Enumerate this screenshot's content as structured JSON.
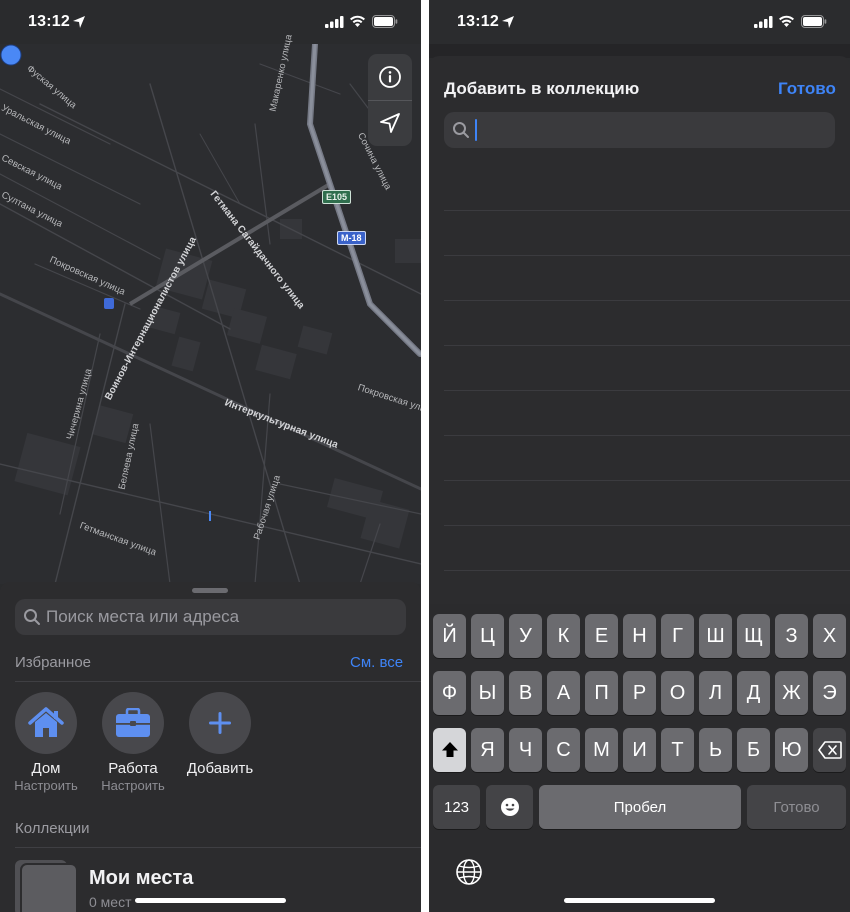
{
  "left": {
    "status": {
      "time": "13:12"
    },
    "map": {
      "labels": [
        "Фуская улица",
        "Уральская улица",
        "Севская улица",
        "Султана улица",
        "Покровская улица",
        "Воинов-Интернационалистов улица",
        "Чичерина улица",
        "Беляева улица",
        "Гетманская улица",
        "Интеркультурная улица",
        "Рабочая улица",
        "Гетмана Сагайдачного улица",
        "Макаренко улица",
        "Сочина улица",
        "Покровская улица"
      ],
      "shields": {
        "e105": "E105",
        "m18": "M-18"
      },
      "info_icon": "info-icon",
      "location_icon": "location-arrow-icon"
    },
    "sheet": {
      "search_placeholder": "Поиск места или адреса",
      "favorites_title": "Избранное",
      "see_all": "См. все",
      "favorites": [
        {
          "icon": "house-icon",
          "label": "Дом",
          "sub": "Настроить"
        },
        {
          "icon": "briefcase-icon",
          "label": "Работа",
          "sub": "Настроить"
        },
        {
          "icon": "plus-icon",
          "label": "Добавить",
          "sub": ""
        }
      ],
      "collections_title": "Коллекции",
      "collection": {
        "title": "Мои места",
        "sub": "0 мест"
      }
    }
  },
  "right": {
    "status": {
      "time": "13:12"
    },
    "modal": {
      "title": "Добавить в коллекцию",
      "done": "Готово",
      "search_value": ""
    },
    "keyboard": {
      "row1": [
        "Й",
        "Ц",
        "У",
        "К",
        "Е",
        "Н",
        "Г",
        "Ш",
        "Щ",
        "З",
        "Х"
      ],
      "row2": [
        "Ф",
        "Ы",
        "В",
        "А",
        "П",
        "Р",
        "О",
        "Л",
        "Д",
        "Ж",
        "Э"
      ],
      "row3": [
        "Я",
        "Ч",
        "С",
        "М",
        "И",
        "Т",
        "Ь",
        "Б",
        "Ю"
      ],
      "numbers": "123",
      "space": "Пробел",
      "return": "Готово",
      "shift_icon": "shift-icon",
      "delete_icon": "delete-icon",
      "emoji_icon": "emoji-icon",
      "globe_icon": "globe-icon"
    }
  },
  "colors": {
    "accent": "#3e84f7",
    "sheet": "#2c2c2e",
    "key": "#6b6b6f"
  }
}
